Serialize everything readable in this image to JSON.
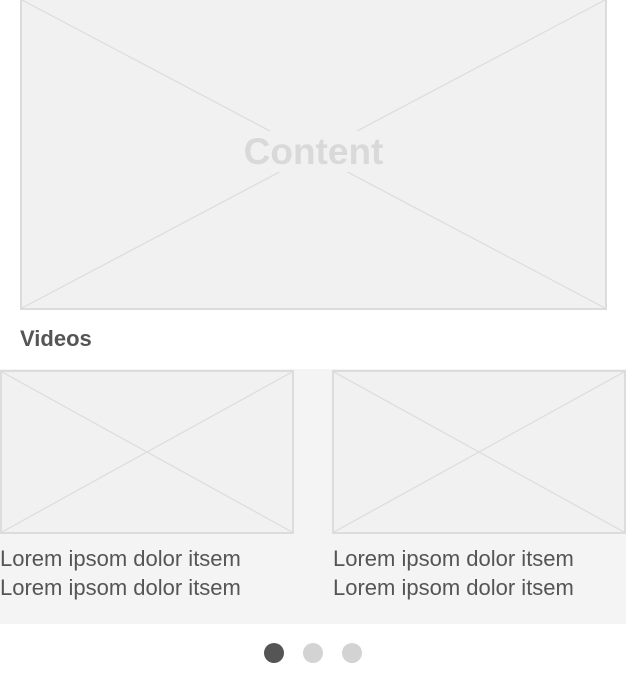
{
  "hero": {
    "label": "Content"
  },
  "videos": {
    "title": "Videos",
    "items": [
      {
        "line1": "Lorem ipsom dolor itsem",
        "line2": "Lorem ipsom dolor itsem"
      },
      {
        "line1": "Lorem ipsom dolor itsem",
        "line2": "Lorem ipsom dolor itsem"
      }
    ]
  },
  "pagination": {
    "page_count": 3,
    "active_page": 1
  },
  "colors": {
    "placeholder_fill": "#f1f1f1",
    "placeholder_stroke": "#dcdcdc",
    "text": "#555555",
    "dot_active": "#555555",
    "dot_inactive": "#d3d3d3"
  }
}
